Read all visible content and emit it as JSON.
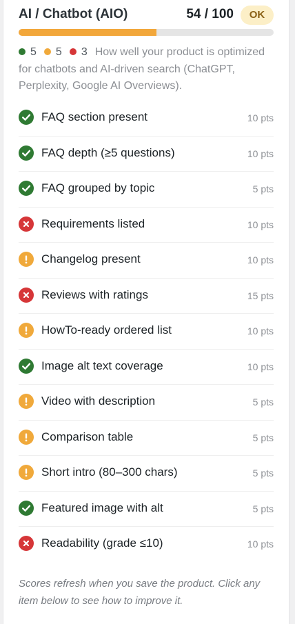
{
  "header": {
    "title": "AI / Chatbot (AIO)",
    "score": "54 / 100",
    "score_value": 54,
    "score_max": 100,
    "badge": "OK"
  },
  "summary": {
    "pass_count": "5",
    "warn_count": "5",
    "fail_count": "3",
    "description": "How well your product is optimized for chatbots and AI-driven search (ChatGPT, Perplexity, Google AI Overviews)."
  },
  "colors": {
    "pass": "#2f7a33",
    "warn": "#f0a93b",
    "fail": "#d63638",
    "progress": "#f2a73b",
    "badge_bg": "#fcefc7"
  },
  "checks": [
    {
      "label": "FAQ section present",
      "points": "10 pts",
      "status": "pass",
      "icon": "check-circle-icon"
    },
    {
      "label": "FAQ depth (≥5 questions)",
      "points": "10 pts",
      "status": "pass",
      "icon": "check-circle-icon"
    },
    {
      "label": "FAQ grouped by topic",
      "points": "5 pts",
      "status": "pass",
      "icon": "check-circle-icon"
    },
    {
      "label": "Requirements listed",
      "points": "10 pts",
      "status": "fail",
      "icon": "x-circle-icon"
    },
    {
      "label": "Changelog present",
      "points": "10 pts",
      "status": "warn",
      "icon": "warning-circle-icon"
    },
    {
      "label": "Reviews with ratings",
      "points": "15 pts",
      "status": "fail",
      "icon": "x-circle-icon"
    },
    {
      "label": "HowTo-ready ordered list",
      "points": "10 pts",
      "status": "warn",
      "icon": "warning-circle-icon"
    },
    {
      "label": "Image alt text coverage",
      "points": "10 pts",
      "status": "pass",
      "icon": "check-circle-icon"
    },
    {
      "label": "Video with description",
      "points": "5 pts",
      "status": "warn",
      "icon": "warning-circle-icon"
    },
    {
      "label": "Comparison table",
      "points": "5 pts",
      "status": "warn",
      "icon": "warning-circle-icon"
    },
    {
      "label": "Short intro (80–300 chars)",
      "points": "5 pts",
      "status": "warn",
      "icon": "warning-circle-icon"
    },
    {
      "label": "Featured image with alt",
      "points": "5 pts",
      "status": "pass",
      "icon": "check-circle-icon"
    },
    {
      "label": "Readability (grade ≤10)",
      "points": "10 pts",
      "status": "fail",
      "icon": "x-circle-icon"
    }
  ],
  "footer": {
    "note": "Scores refresh when you save the product. Click any item below to see how to improve it."
  }
}
